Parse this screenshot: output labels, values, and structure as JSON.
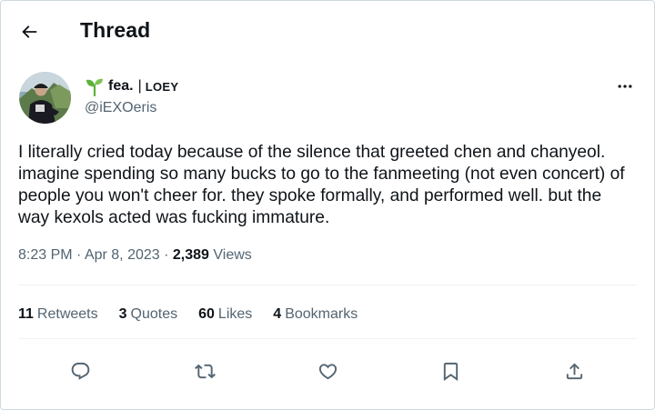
{
  "header": {
    "back_icon": "arrow-left-icon",
    "title": "Thread"
  },
  "author": {
    "display_name": "fea.",
    "separator": "|",
    "tag": "LOEY",
    "handle": "@iEXOeris",
    "badge_icon": "sprout-icon"
  },
  "tweet": {
    "text": "I literally cried today because of the silence that greeted chen and chanyeol. imagine spending so many bucks to go to the fanmeeting (not even concert) of people you won't cheer for. they spoke formally, and performed well. but the way kexols acted was fucking immature.",
    "time": "8:23 PM",
    "date": "Apr 8, 2023",
    "views_count": "2,389",
    "views_label": "Views"
  },
  "stats": {
    "retweets_count": "11",
    "retweets_label": "Retweets",
    "quotes_count": "3",
    "quotes_label": "Quotes",
    "likes_count": "60",
    "likes_label": "Likes",
    "bookmarks_count": "4",
    "bookmarks_label": "Bookmarks"
  },
  "actions": [
    "reply-icon",
    "retweet-icon",
    "like-icon",
    "bookmark-icon",
    "share-icon"
  ],
  "colors": {
    "text_primary": "#0f1419",
    "text_secondary": "#536471",
    "divider": "#eff3f4",
    "sprout_green": "#5bb33b"
  }
}
